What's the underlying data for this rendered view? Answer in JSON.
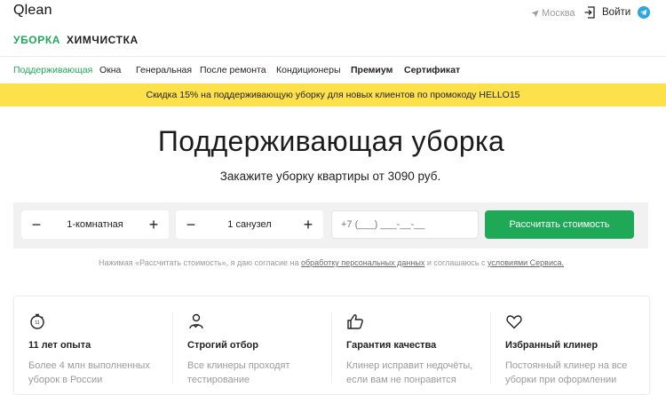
{
  "header": {
    "logo": "Qlean",
    "city": "Москва",
    "login_label": "Войти",
    "services": [
      "УБОРКА",
      "ХИМЧИСТКА"
    ]
  },
  "subnav": [
    {
      "label": "Поддерживающая",
      "active": true
    },
    {
      "label": "Окна"
    },
    {
      "label": "Генеральная"
    },
    {
      "label": "После ремонта"
    },
    {
      "label": "Кондиционеры"
    },
    {
      "label": "Премиум",
      "bold": true
    },
    {
      "label": "Сертификат",
      "bold": true
    }
  ],
  "promo": "Скидка 15% на поддерживающую уборку для новых клиентов по промокоду HELLO15",
  "hero": {
    "title": "Поддерживающая уборка",
    "subtitle": "Закажите уборку квартиры от 3090 руб."
  },
  "form": {
    "rooms": "1-комнатная",
    "bathrooms": "1 санузел",
    "minus": "−",
    "plus": "+",
    "phone_placeholder": "+7 (___) ___-__-__",
    "submit": "Рассчитать стоимость"
  },
  "consent": {
    "prefix": "Нажимая «Рассчитать стоимость», я даю согласие на",
    "link1": "обработку персональных данных",
    "middle": "и соглашаюсь с",
    "link2": "условиями Сервиса."
  },
  "features": [
    {
      "icon": "timer-icon",
      "title": "11 лет опыта",
      "desc": "Более 4 млн выполненных уборок в России"
    },
    {
      "icon": "person-check-icon",
      "title": "Строгий отбор",
      "desc": "Все клинеры проходят тестирование"
    },
    {
      "icon": "thumbs-up-icon",
      "title": "Гарантия качества",
      "desc": "Клинер исправит недочёты, если вам не понравится"
    },
    {
      "icon": "heart-icon",
      "title": "Избранный клинер",
      "desc": "Постоянный клинер на все уборки при оформлении"
    }
  ],
  "colors": {
    "accent": "#1fa957",
    "promo_bg": "#fde14b",
    "telegram": "#2ca5e0",
    "text": "#222222",
    "muted": "#9a9a9a"
  }
}
